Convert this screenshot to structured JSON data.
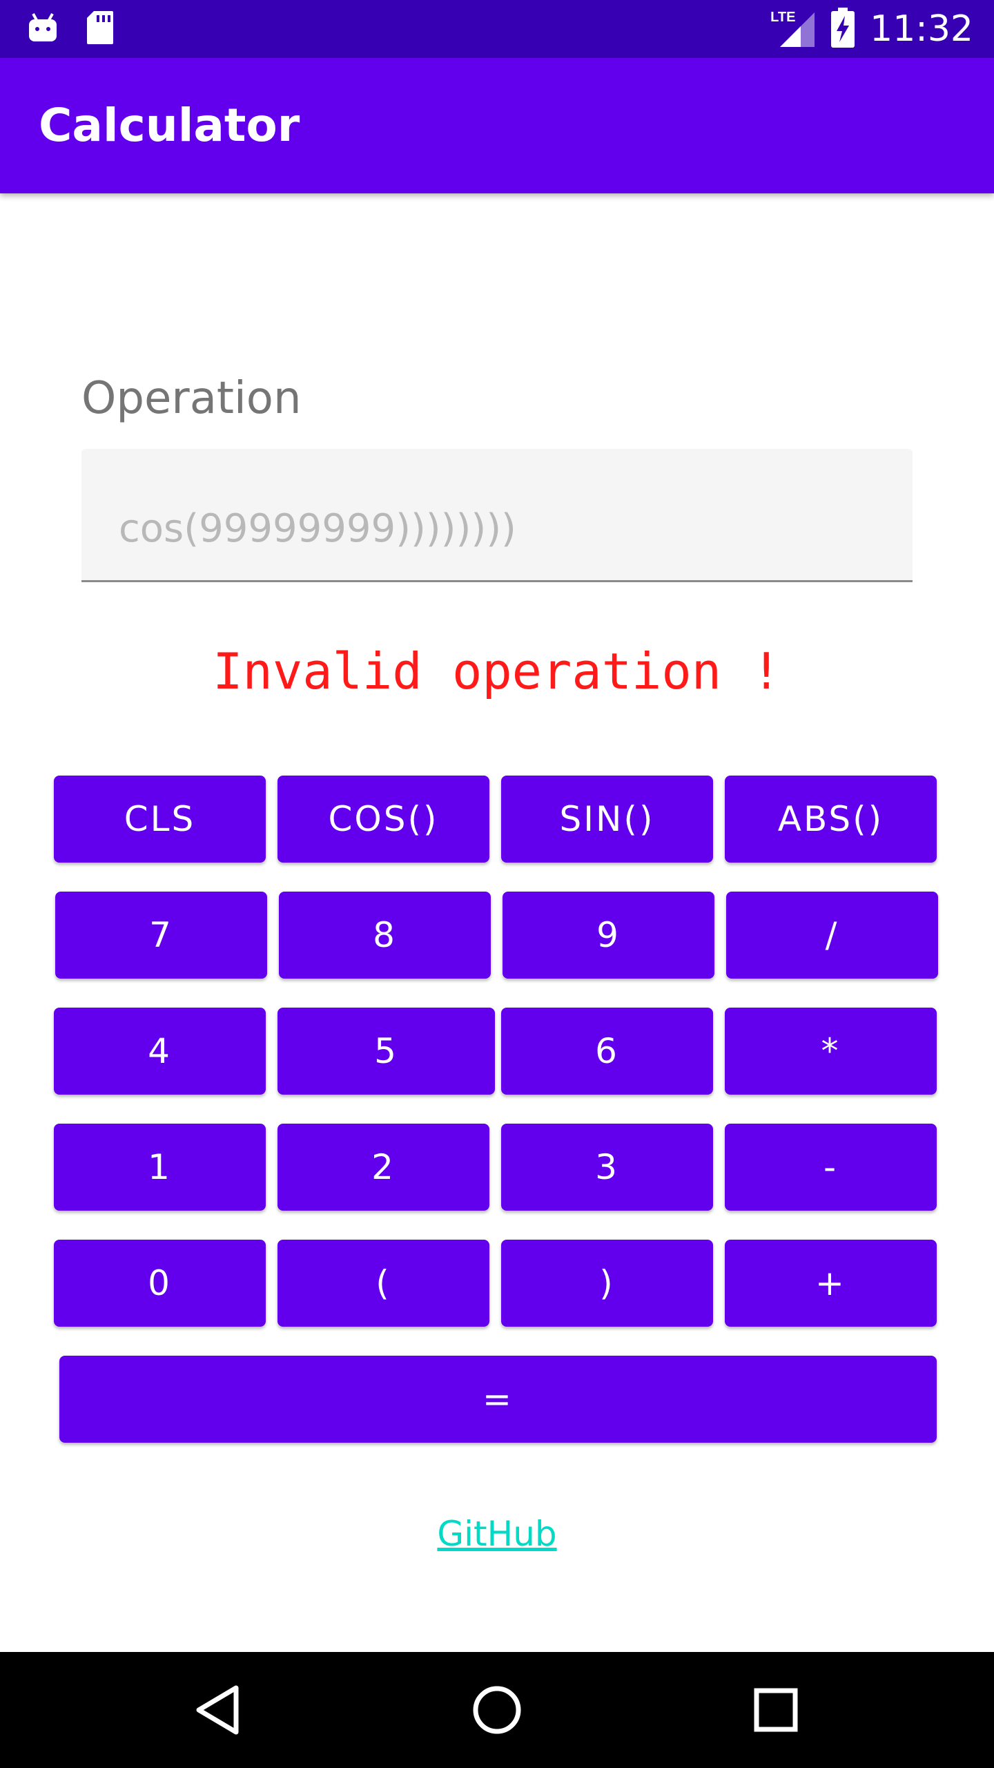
{
  "status_bar": {
    "time": "11:32",
    "network": "LTE",
    "icons": [
      "android-notification-icon",
      "sd-card-icon",
      "lte-signal-icon",
      "battery-charging-icon"
    ]
  },
  "app_bar": {
    "title": "Calculator"
  },
  "operation": {
    "label": "Operation",
    "value": "",
    "placeholder": "cos(99999999))))))))"
  },
  "error": {
    "message": "Invalid operation !"
  },
  "keypad": {
    "rows": [
      [
        "CLS",
        "COS()",
        "SIN()",
        "ABS()"
      ],
      [
        "7",
        "8",
        "9",
        "/"
      ],
      [
        "4",
        "5",
        "6",
        "*"
      ],
      [
        "1",
        "2",
        "3",
        "-"
      ],
      [
        "0",
        "(",
        ")",
        "+"
      ]
    ],
    "equals": "="
  },
  "footer": {
    "link": "GitHub"
  },
  "nav_bar": {
    "icons": [
      "back-icon",
      "home-icon",
      "recents-icon"
    ]
  },
  "colors": {
    "status_bar": "#3700b3",
    "primary": "#6200ee",
    "error": "#ff1a1a",
    "link": "#03dac5"
  }
}
